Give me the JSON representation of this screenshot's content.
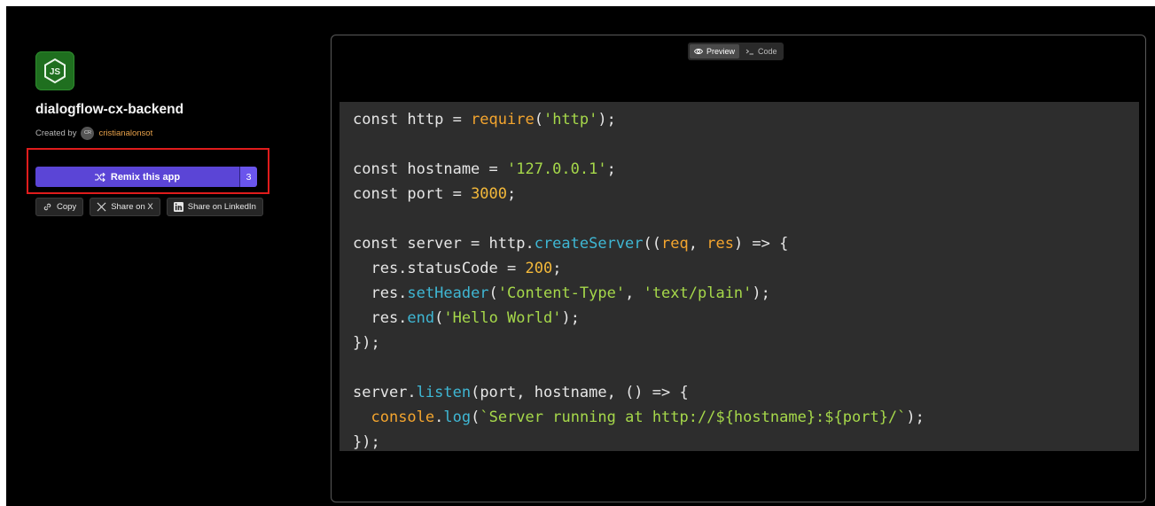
{
  "app": {
    "title": "dialogflow-cx-backend",
    "created_by_label": "Created by",
    "avatar_initials": "CR",
    "creator": "cristianalonsot",
    "logo_icon": "nodejs-icon",
    "colors": {
      "accent": "#5b45d6",
      "creator": "#e9a24a",
      "logo_bg": "#1f6f1f"
    }
  },
  "actions": {
    "remix_label": "Remix this app",
    "remix_count": "3",
    "copy_label": "Copy",
    "share_x_label": "Share on X",
    "share_linkedin_label": "Share on LinkedIn"
  },
  "preview": {
    "tabs": [
      {
        "label": "Preview",
        "icon": "eye-icon",
        "active": true
      },
      {
        "label": "Code",
        "icon": "terminal-icon",
        "active": false
      }
    ],
    "code_lines": [
      "const http = require('http');",
      "",
      "const hostname = '127.0.0.1';",
      "const port = 3000;",
      "",
      "const server = http.createServer((req, res) => {",
      "  res.statusCode = 200;",
      "  res.setHeader('Content-Type', 'text/plain');",
      "  res.end('Hello World');",
      "});",
      "",
      "server.listen(port, hostname, () => {",
      "  console.log(`Server running at http://${hostname}:${port}/`);",
      "});"
    ]
  }
}
